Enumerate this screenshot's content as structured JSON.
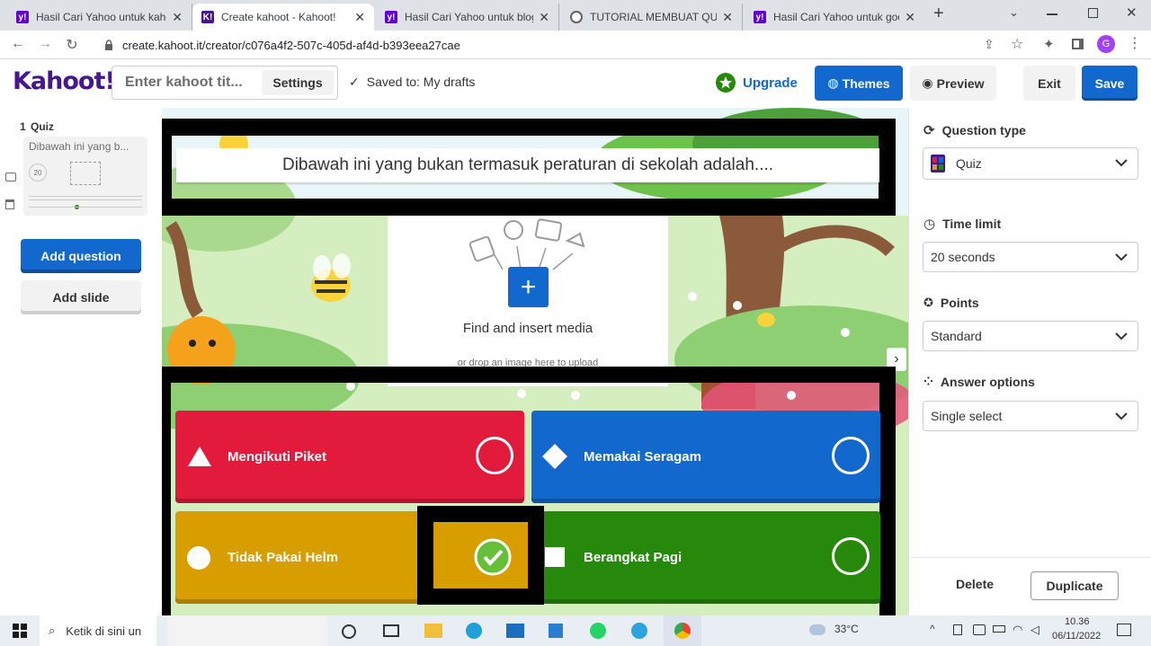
{
  "browser": {
    "tabs": [
      {
        "title": "Hasil Cari Yahoo untuk kahoot",
        "icon": "yahoo-icon",
        "color": "#6001d2"
      },
      {
        "title": "Create kahoot - Kahoot!",
        "icon": "kahoot-icon",
        "color": "#46178f"
      },
      {
        "title": "Hasil Cari Yahoo untuk blog c",
        "icon": "yahoo-icon",
        "color": "#6001d2"
      },
      {
        "title": "TUTORIAL MEMBUAT QUIS C",
        "icon": "globe-icon",
        "color": "#5f6368"
      },
      {
        "title": "Hasil Cari Yahoo untuk goog",
        "icon": "yahoo-icon",
        "color": "#6001d2"
      }
    ],
    "url": "create.kahoot.it/creator/c076a4f2-507c-405d-af4d-b393eea27cae"
  },
  "header": {
    "logo": "Kahoot!",
    "title_placeholder": "Enter kahoot tit...",
    "settings_label": "Settings",
    "saved_label": "Saved to: My drafts",
    "upgrade_label": "Upgrade",
    "themes_label": "Themes",
    "preview_label": "Preview",
    "exit_label": "Exit",
    "save_label": "Save"
  },
  "sidebar": {
    "slide_number": "1",
    "slide_type": "Quiz",
    "slide_preview_text": "Dibawah ini yang b...",
    "slide_time": "20",
    "add_question_label": "Add question",
    "add_slide_label": "Add slide"
  },
  "editor": {
    "question": "Dibawah ini yang bukan termasuk peraturan di sekolah adalah....",
    "media_title": "Find and insert media",
    "media_hint": "or drop an image here to upload",
    "answers": [
      {
        "text": "Mengikuti Piket",
        "shape": "triangle-icon",
        "color": "#e21b3c",
        "correct": false
      },
      {
        "text": "Memakai Seragam",
        "shape": "diamond-icon",
        "color": "#1368ce",
        "correct": false
      },
      {
        "text": "Tidak Pakai Helm",
        "shape": "circle-icon",
        "color": "#d89e00",
        "correct": true
      },
      {
        "text": "Berangkat Pagi",
        "shape": "square-icon",
        "color": "#26890c",
        "correct": false
      }
    ]
  },
  "settings_panel": {
    "question_type_label": "Question type",
    "question_type_value": "Quiz",
    "time_limit_label": "Time limit",
    "time_limit_value": "20 seconds",
    "points_label": "Points",
    "points_value": "Standard",
    "answer_options_label": "Answer options",
    "answer_options_value": "Single select",
    "delete_label": "Delete",
    "duplicate_label": "Duplicate"
  },
  "taskbar": {
    "search_placeholder": "Ketik di sini un",
    "weather": "33°C",
    "time": "10.36",
    "date": "06/11/2022"
  }
}
